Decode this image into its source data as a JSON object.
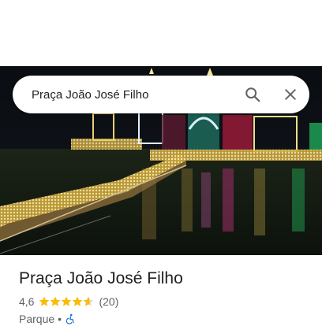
{
  "search": {
    "query": "Praça João José Filho",
    "search_icon": "search-icon",
    "close_icon": "close-icon"
  },
  "place": {
    "name": "Praça João José Filho",
    "rating": "4,6",
    "rating_value": 4.6,
    "review_count": "(20)",
    "type": "Parque",
    "separator": "•",
    "accessibility_icon": "wheelchair-icon"
  },
  "colors": {
    "star": "#fbbc04",
    "accessibility": "#1a73e8",
    "text_primary": "#202124",
    "text_secondary": "#5f6368"
  }
}
